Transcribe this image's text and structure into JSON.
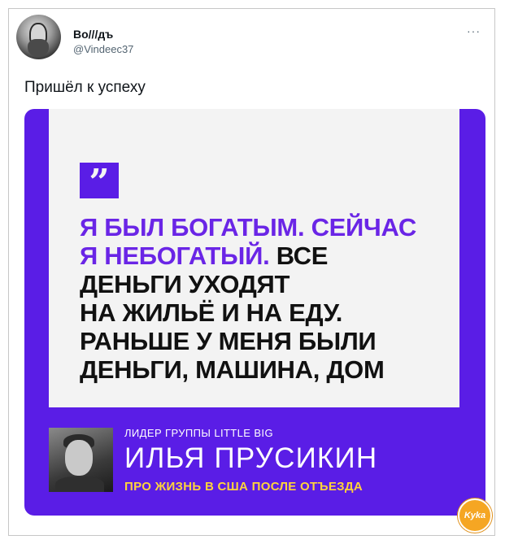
{
  "author": {
    "name": "Bo///дъ",
    "handle": "@Vindeec37",
    "avatar_icon": "portrait-avatar-icon"
  },
  "more_icon": "···",
  "tweet_text": "Пришёл к успеху",
  "card": {
    "quote_mark": "”",
    "quote_lines": [
      {
        "segments": [
          {
            "text": "Я БЫЛ БОГАТЫМ. СЕЙЧАС",
            "color": "purple"
          }
        ]
      },
      {
        "segments": [
          {
            "text": "Я НЕБОГАТЫЙ.",
            "color": "purple"
          },
          {
            "text": " ВСЕ",
            "color": "dark"
          }
        ]
      },
      {
        "segments": [
          {
            "text": "ДЕНЬГИ УХОДЯТ",
            "color": "dark"
          }
        ]
      },
      {
        "segments": [
          {
            "text": "НА ЖИЛЬЁ И НА ЕДУ.",
            "color": "dark"
          }
        ]
      },
      {
        "segments": [
          {
            "text": "РАНЬШЕ У МЕНЯ БЫЛИ",
            "color": "dark"
          }
        ]
      },
      {
        "segments": [
          {
            "text": "ДЕНЬГИ, МАШИНА, ДОМ",
            "color": "dark"
          }
        ]
      }
    ],
    "caption_small": "ЛИДЕР ГРУППЫ LITTLE BIG",
    "caption_name": "ИЛЬЯ ПРУСИКИН",
    "caption_yellow": "ПРО ЖИЗНЬ В США ПОСЛЕ ОТЪЕЗДА",
    "colors": {
      "purple": "#5a1de6",
      "highlight": "#6a25e6",
      "yellow": "#ffd43b",
      "panel": "#f3f3f3"
    }
  },
  "watermark": "Kyka"
}
